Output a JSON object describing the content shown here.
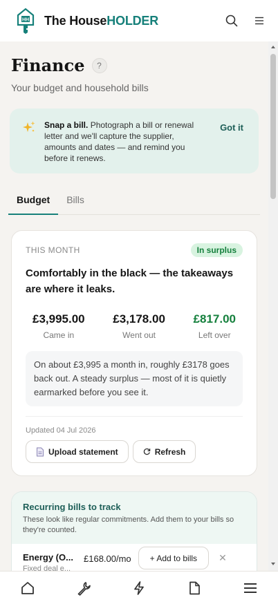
{
  "app": {
    "brand_main": "The House",
    "brand_accent": "HOLDER",
    "logo_letters": "HH"
  },
  "header": {
    "icons": [
      "search-icon",
      "menu-icon"
    ]
  },
  "page": {
    "title": "Finance",
    "help": "?",
    "subtitle": "Your budget and household bills"
  },
  "tip": {
    "lead": "Snap a bill.",
    "text": " Photograph a bill or renewal letter and we'll capture the supplier, amounts and dates — and remind you before it renews.",
    "action": "Got it",
    "icon": "sparkles-icon"
  },
  "tabs": [
    {
      "label": "Budget",
      "active": true
    },
    {
      "label": "Bills",
      "active": false
    }
  ],
  "summary_card": {
    "eyebrow": "THIS MONTH",
    "status": "In surplus",
    "headline": "Comfortably in the black — the takeaways are where it leaks.",
    "stats": [
      {
        "value": "£3,995.00",
        "label": "Came in"
      },
      {
        "value": "£3,178.00",
        "label": "Went out"
      },
      {
        "value": "£817.00",
        "label": "Left over"
      }
    ],
    "summary": "On about £3,995 a month in, roughly £3178 goes back out. A steady surplus — most of it is quietly earmarked before you see it.",
    "updated": "Updated 04 Jul 2026",
    "upload_label": "Upload statement",
    "refresh_label": "Refresh"
  },
  "recurring": {
    "title": "Recurring bills to track",
    "description": "These look like regular commitments. Add them to your bills so they're counted.",
    "items": [
      {
        "name": "Energy (O...",
        "sub": "Fixed deal e...",
        "amount": "£168.00/mo",
        "action": "+ Add to bills"
      }
    ]
  },
  "colors": {
    "accent": "#16807a",
    "surplus": "#15803d",
    "tip_bg": "#e3f1ec"
  },
  "bottom_nav": [
    "home-icon",
    "wrench-icon",
    "lightning-icon",
    "document-icon",
    "menu-icon"
  ]
}
